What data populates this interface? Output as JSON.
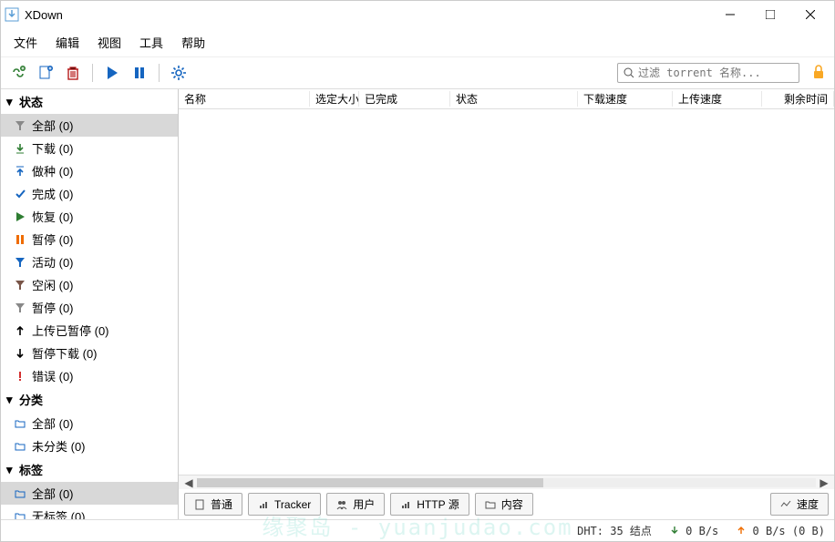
{
  "title": "XDown",
  "menu": {
    "file": "文件",
    "edit": "编辑",
    "view": "视图",
    "tools": "工具",
    "help": "帮助"
  },
  "search": {
    "placeholder": "过滤 torrent 名称..."
  },
  "sidebar": {
    "status": {
      "header": "状态",
      "items": [
        {
          "label": "全部 (0)"
        },
        {
          "label": "下载 (0)"
        },
        {
          "label": "做种 (0)"
        },
        {
          "label": "完成 (0)"
        },
        {
          "label": "恢复 (0)"
        },
        {
          "label": "暂停 (0)"
        },
        {
          "label": "活动 (0)"
        },
        {
          "label": "空闲 (0)"
        },
        {
          "label": "暂停 (0)"
        },
        {
          "label": "上传已暂停 (0)"
        },
        {
          "label": "暂停下载 (0)"
        },
        {
          "label": "错误 (0)"
        }
      ]
    },
    "category": {
      "header": "分类",
      "items": [
        {
          "label": "全部 (0)"
        },
        {
          "label": "未分类 (0)"
        }
      ]
    },
    "tags": {
      "header": "标签",
      "items": [
        {
          "label": "全部 (0)"
        },
        {
          "label": "无标签 (0)"
        }
      ]
    }
  },
  "columns": {
    "name": "名称",
    "selected_size": "选定大小",
    "completed": "已完成",
    "status": "状态",
    "dl_speed": "下载速度",
    "ul_speed": "上传速度",
    "eta": "剩余时间"
  },
  "tabs": {
    "general": "普通",
    "tracker": "Tracker",
    "peers": "用户",
    "http": "HTTP 源",
    "content": "内容",
    "speed": "速度"
  },
  "statusbar": {
    "dht": "DHT: 35 结点",
    "dl": "0 B/s",
    "ul": "0 B/s (0 B)"
  },
  "watermark": "缘聚岛 - yuanjudao.com"
}
